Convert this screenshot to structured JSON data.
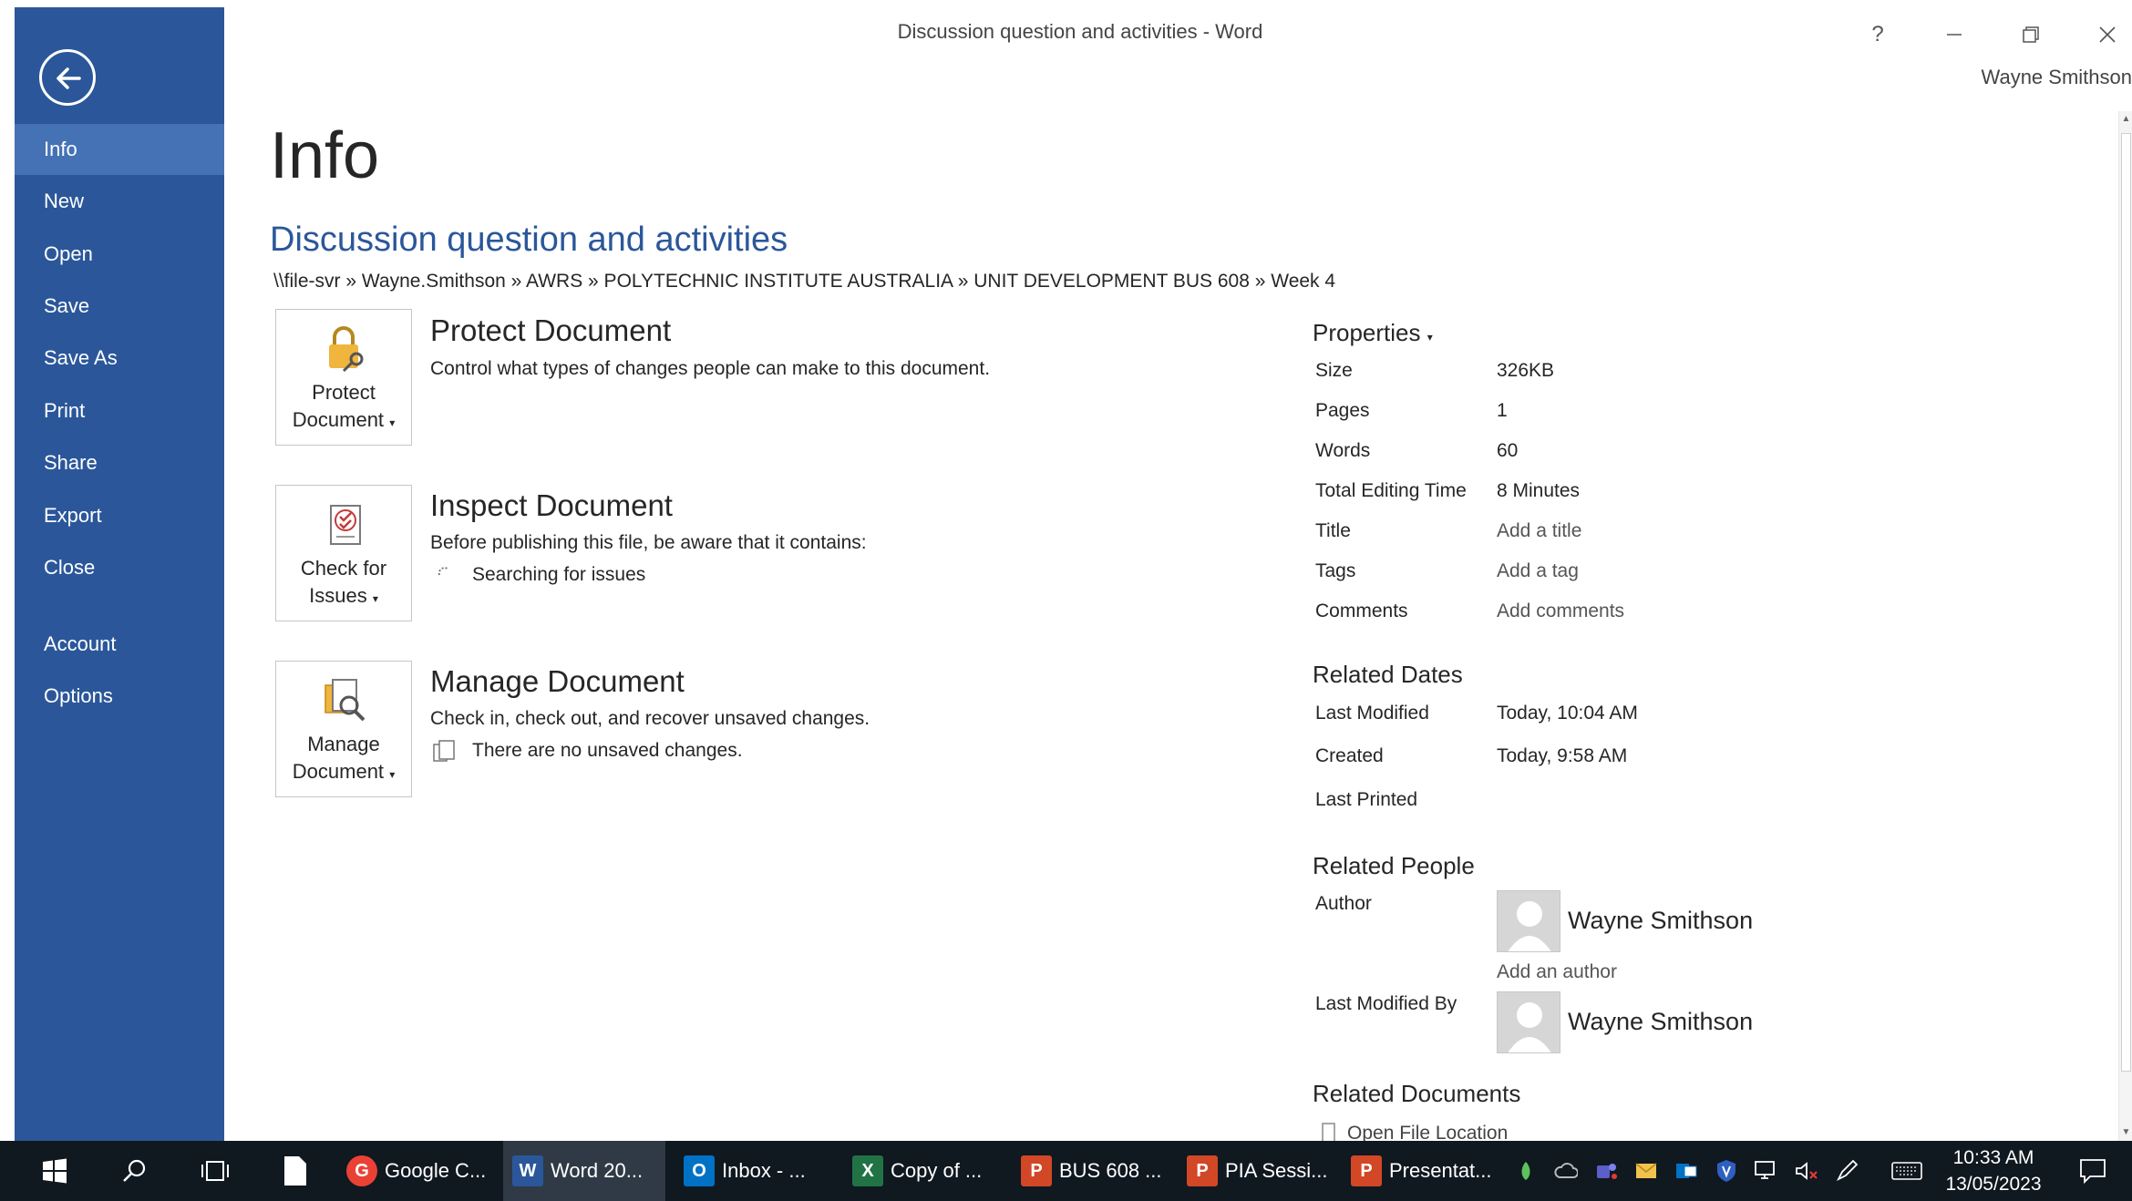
{
  "window": {
    "title": "Discussion question and activities - Word",
    "help_label": "?",
    "user_name": "Wayne Smithson"
  },
  "sidebar": {
    "items": [
      {
        "label": "Info"
      },
      {
        "label": "New"
      },
      {
        "label": "Open"
      },
      {
        "label": "Save"
      },
      {
        "label": "Save As"
      },
      {
        "label": "Print"
      },
      {
        "label": "Share"
      },
      {
        "label": "Export"
      },
      {
        "label": "Close"
      },
      {
        "label": "Account"
      },
      {
        "label": "Options"
      }
    ]
  },
  "main": {
    "page_title": "Info",
    "doc_title": "Discussion question and activities",
    "doc_path": "\\\\file-svr » Wayne.Smithson » AWRS » POLYTECHNIC INSTITUTE AUSTRALIA » UNIT DEVELOPMENT BUS 608 » Week 4",
    "protect": {
      "tile_line1": "Protect",
      "tile_line2": "Document",
      "heading": "Protect Document",
      "description": "Control what types of changes people can make to this document."
    },
    "inspect": {
      "tile_line1": "Check for",
      "tile_line2": "Issues",
      "heading": "Inspect Document",
      "description": "Before publishing this file, be aware that it contains:",
      "status": "Searching for issues"
    },
    "manage": {
      "tile_line1": "Manage",
      "tile_line2": "Document",
      "heading": "Manage Document",
      "description": "Check in, check out, and recover unsaved changes.",
      "status": "There are no unsaved changes."
    }
  },
  "properties": {
    "heading": "Properties",
    "size_label": "Size",
    "size_value": "326KB",
    "pages_label": "Pages",
    "pages_value": "1",
    "words_label": "Words",
    "words_value": "60",
    "editing_label": "Total Editing Time",
    "editing_value": "8 Minutes",
    "title_label": "Title",
    "title_placeholder": "Add a title",
    "tags_label": "Tags",
    "tags_placeholder": "Add a tag",
    "comments_label": "Comments",
    "comments_placeholder": "Add comments"
  },
  "related_dates": {
    "heading": "Related Dates",
    "modified_label": "Last Modified",
    "modified_value": "Today, 10:04 AM",
    "created_label": "Created",
    "created_value": "Today, 9:58 AM",
    "printed_label": "Last Printed"
  },
  "related_people": {
    "heading": "Related People",
    "author_label": "Author",
    "author_name": "Wayne Smithson",
    "add_author": "Add an author",
    "modified_by_label": "Last Modified By",
    "modified_by_name": "Wayne Smithson"
  },
  "related_documents": {
    "heading": "Related Documents",
    "open_location": "Open File Location"
  },
  "taskbar": {
    "apps": [
      {
        "label": "Google C...",
        "icon_letter": "G",
        "color": "#e94235"
      },
      {
        "label": "Word 20...",
        "icon_letter": "W",
        "color": "#2b579a"
      },
      {
        "label": "Inbox - ...",
        "icon_letter": "O",
        "color": "#0072c6"
      },
      {
        "label": "Copy of ...",
        "icon_letter": "X",
        "color": "#217346"
      },
      {
        "label": "BUS 608 ...",
        "icon_letter": "P",
        "color": "#d24726"
      },
      {
        "label": "PIA Sessi...",
        "icon_letter": "P",
        "color": "#d24726"
      },
      {
        "label": "Presentat...",
        "icon_letter": "P",
        "color": "#d24726"
      }
    ],
    "time": "10:33 AM",
    "date": "13/05/2023"
  },
  "colors": {
    "accent": "#2b579a",
    "sidebar_active": "#4472b5",
    "taskbar": "#101820"
  }
}
